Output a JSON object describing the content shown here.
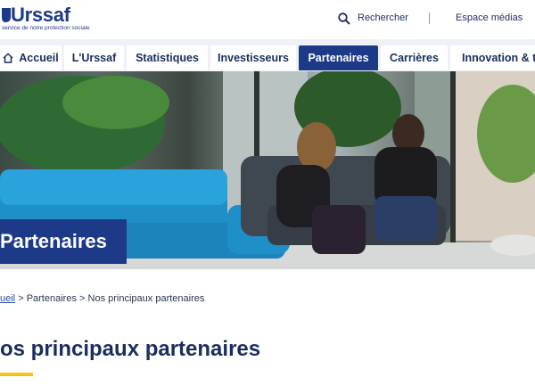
{
  "header": {
    "logo_text": "Urssaf",
    "logo_tagline": "service de notre protection sociale",
    "search_label": "Rechercher",
    "media_label": "Espace médias"
  },
  "nav": {
    "items": [
      {
        "label": "Accueil"
      },
      {
        "label": "L'Urssaf"
      },
      {
        "label": "Statistiques"
      },
      {
        "label": "Investisseurs"
      },
      {
        "label": "Partenaires"
      },
      {
        "label": "Carrières"
      },
      {
        "label": "Innovation & tec"
      }
    ],
    "active_index": 4
  },
  "hero": {
    "title": "Partenaires"
  },
  "breadcrumb": {
    "home": "ueil",
    "sep1": ">",
    "level1": "Partenaires",
    "sep2": ">",
    "current": "Nos principaux partenaires"
  },
  "page": {
    "title": "os principaux partenaires"
  },
  "colors": {
    "brand_blue": "#1c3a87",
    "accent_yellow": "#f5c415",
    "nav_background": "#eef1f6"
  }
}
